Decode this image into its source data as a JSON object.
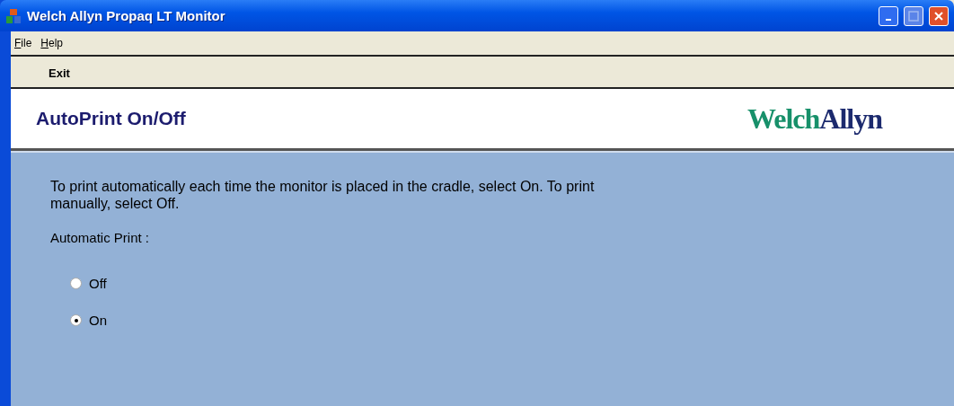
{
  "window": {
    "title": "Welch Allyn Propaq LT Monitor"
  },
  "menu": [
    "File",
    "Help"
  ],
  "toolbar": [
    "Exit"
  ],
  "header": {
    "title": "AutoPrint On/Off",
    "logo": {
      "first": "Welch",
      "second": "Allyn"
    }
  },
  "description": "To print automatically each time the monitor is placed in the cradle, select On. To print manually, select Off.",
  "automatic_print": {
    "label": "Automatic Print :",
    "options": [
      {
        "label": "Off",
        "selected": false
      },
      {
        "label": "On",
        "selected": true
      }
    ]
  }
}
